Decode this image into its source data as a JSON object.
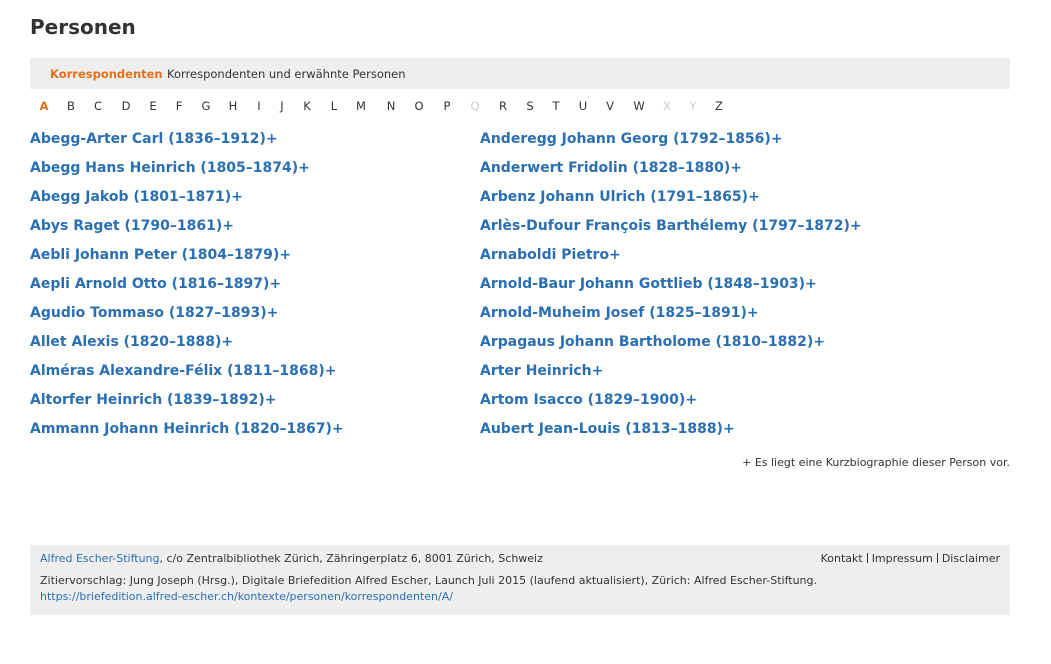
{
  "page": {
    "title": "Personen"
  },
  "tabs": {
    "active": "Korrespondenten",
    "other": "Korrespondenten und erwähnte Personen"
  },
  "alphabet": {
    "letters": [
      "A",
      "B",
      "C",
      "D",
      "E",
      "F",
      "G",
      "H",
      "I",
      "J",
      "K",
      "L",
      "M",
      "N",
      "O",
      "P",
      "Q",
      "R",
      "S",
      "T",
      "U",
      "V",
      "W",
      "X",
      "Y",
      "Z"
    ],
    "active": "A",
    "disabled": [
      "Q",
      "X",
      "Y"
    ]
  },
  "persons": {
    "left": [
      "Abegg-Arter Carl (1836–1912)+",
      "Abegg Hans Heinrich (1805–1874)+",
      "Abegg Jakob (1801–1871)+",
      "Abys Raget (1790–1861)+",
      "Aebli Johann Peter (1804–1879)+",
      "Aepli Arnold Otto (1816–1897)+",
      "Agudio Tommaso (1827–1893)+",
      "Allet Alexis (1820–1888)+",
      "Alméras Alexandre-Félix (1811–1868)+",
      "Altorfer Heinrich (1839–1892)+",
      "Ammann Johann Heinrich (1820–1867)+"
    ],
    "right": [
      "Anderegg Johann Georg (1792–1856)+",
      "Anderwert Fridolin (1828–1880)+",
      "Arbenz Johann Ulrich (1791–1865)+",
      "Arlès-Dufour François Barthélemy (1797–1872)+",
      "Arnaboldi Pietro+",
      "Arnold-Baur Johann Gottlieb (1848–1903)+",
      "Arnold-Muheim Josef (1825–1891)+",
      "Arpagaus Johann Bartholome (1810–1882)+",
      "Arter Heinrich+",
      "Artom Isacco (1829–1900)+",
      "Aubert Jean-Louis (1813–1888)+"
    ]
  },
  "note": "+ Es liegt eine Kurzbiographie dieser Person vor.",
  "footer": {
    "org_link": "Alfred Escher-Stiftung",
    "address": ", c/o Zentralbibliothek Zürich, Zähringerplatz 6, 8001 Zürich, Schweiz",
    "nav": [
      "Kontakt",
      "Impressum",
      "Disclaimer"
    ],
    "citation": "Zitiervorschlag: Jung Joseph (Hrsg.), Digitale Briefedition Alfred Escher, Launch Juli 2015 (laufend aktualisiert), Zürich: Alfred Escher-Stiftung.",
    "url": "https://briefedition.alfred-escher.ch/kontexte/personen/korrespondenten/A/"
  },
  "colors": {
    "accent": "#e2701e",
    "link": "#2a6fb3",
    "panel": "#eeeeee"
  }
}
